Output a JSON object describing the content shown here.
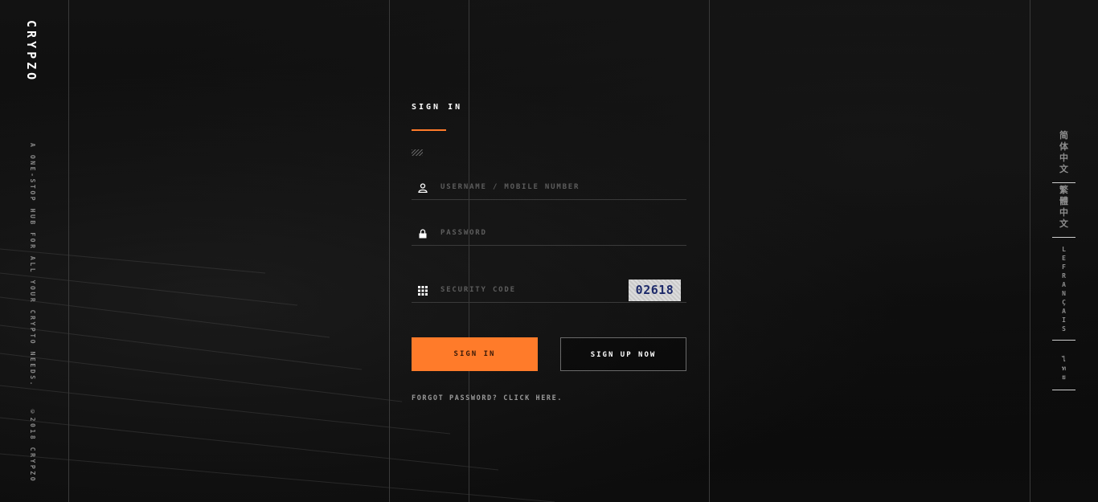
{
  "brand": {
    "logo_text": "CRYPZO",
    "tagline": "A ONE-STOP HUB FOR ALL YOUR CRYPTO NEEDS.",
    "copyright": "©2018 CRYPZO"
  },
  "form": {
    "title": "SIGN IN",
    "username_placeholder": "USERNAME / MOBILE NUMBER",
    "password_placeholder": "PASSWORD",
    "security_placeholder": "SECURITY CODE",
    "captcha_text": "02618",
    "signin_label": "SIGN IN",
    "signup_label": "SIGN UP NOW",
    "forgot_text": "FORGOT PASSWORD? CLICK HERE."
  },
  "languages": [
    "简体中文",
    "繁體中文",
    "LE FRANÇAIS",
    "ไทย"
  ],
  "colors": {
    "accent": "#ff7b2a",
    "background": "#0b0b0b",
    "line": "#3a3a3a"
  },
  "icons": {
    "username": "user-icon",
    "password": "lock-icon",
    "security": "grid-icon"
  }
}
